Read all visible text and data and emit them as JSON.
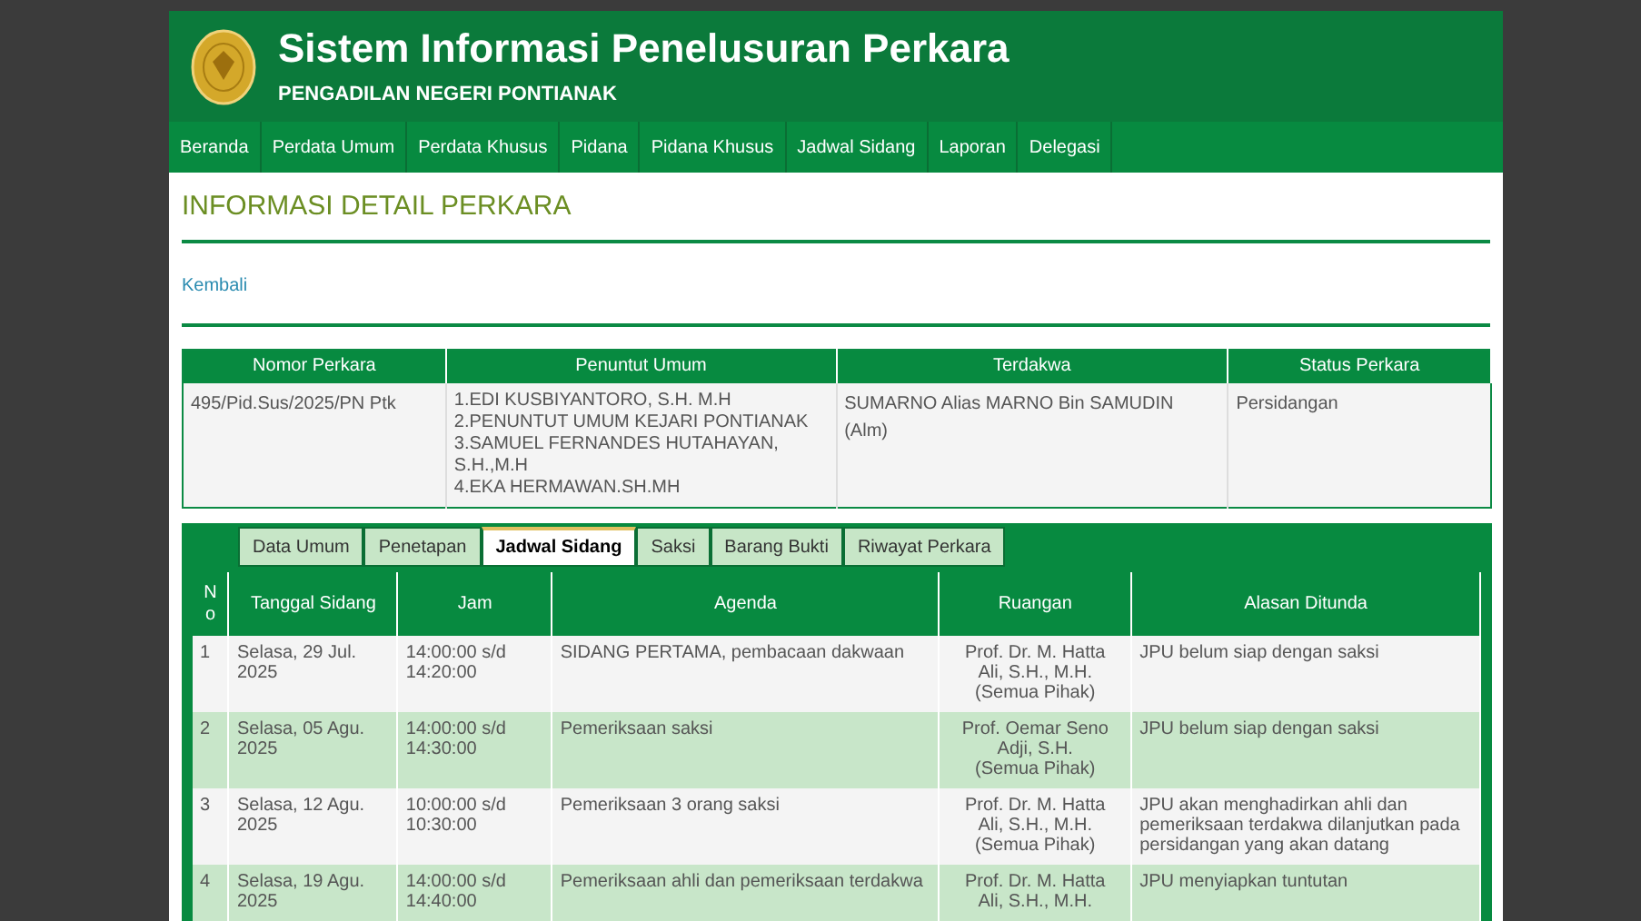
{
  "header": {
    "title": "Sistem Informasi Penelusuran Perkara",
    "subtitle": "PENGADILAN NEGERI PONTIANAK"
  },
  "nav": [
    {
      "label": "Beranda"
    },
    {
      "label": "Perdata Umum"
    },
    {
      "label": "Perdata Khusus"
    },
    {
      "label": "Pidana"
    },
    {
      "label": "Pidana Khusus"
    },
    {
      "label": "Jadwal Sidang"
    },
    {
      "label": "Laporan"
    },
    {
      "label": "Delegasi"
    }
  ],
  "page_title": "INFORMASI DETAIL PERKARA",
  "back_link": "Kembali",
  "case_table": {
    "columns": [
      "Nomor Perkara",
      "Penuntut Umum",
      "Terdakwa",
      "Status Perkara"
    ],
    "row": {
      "nomor": "495/Pid.Sus/2025/PN Ptk",
      "penuntut": [
        "1.EDI KUSBIYANTORO, S.H. M.H",
        "2.PENUNTUT UMUM KEJARI PONTIANAK",
        "3.SAMUEL FERNANDES HUTAHAYAN, S.H.,M.H",
        "4.EKA HERMAWAN.SH.MH"
      ],
      "terdakwa": "SUMARNO Alias MARNO Bin SAMUDIN (Alm)",
      "status": "Persidangan"
    }
  },
  "tabs": [
    {
      "label": "Data Umum",
      "selected": false
    },
    {
      "label": "Penetapan",
      "selected": false
    },
    {
      "label": "Jadwal Sidang",
      "selected": true
    },
    {
      "label": "Saksi",
      "selected": false
    },
    {
      "label": "Barang Bukti",
      "selected": false
    },
    {
      "label": "Riwayat Perkara",
      "selected": false
    }
  ],
  "schedule_table": {
    "columns": [
      "No",
      "Tanggal Sidang",
      "Jam",
      "Agenda",
      "Ruangan",
      "Alasan Ditunda"
    ],
    "rows": [
      {
        "no": "1",
        "tanggal": "Selasa, 29 Jul. 2025",
        "jam": "14:00:00 s/d 14:20:00",
        "agenda": "SIDANG PERTAMA, pembacaan dakwaan",
        "ruangan": [
          "Prof. Dr. M. Hatta",
          "Ali, S.H., M.H.",
          "(Semua Pihak)"
        ],
        "alasan": "JPU belum siap dengan saksi"
      },
      {
        "no": "2",
        "tanggal": "Selasa, 05 Agu. 2025",
        "jam": "14:00:00 s/d 14:30:00",
        "agenda": "Pemeriksaan saksi",
        "ruangan": [
          "Prof. Oemar Seno",
          "Adji, S.H.",
          "(Semua Pihak)"
        ],
        "alasan": "JPU belum siap dengan saksi"
      },
      {
        "no": "3",
        "tanggal": "Selasa, 12 Agu. 2025",
        "jam": "10:00:00 s/d 10:30:00",
        "agenda": "Pemeriksaan 3 orang saksi",
        "ruangan": [
          "Prof. Dr. M. Hatta",
          "Ali, S.H., M.H.",
          "(Semua Pihak)"
        ],
        "alasan": "JPU akan menghadirkan ahli dan pemeriksaan terdakwa dilanjutkan pada persidangan yang akan datang"
      },
      {
        "no": "4",
        "tanggal": "Selasa, 19 Agu. 2025",
        "jam": "14:00:00 s/d 14:40:00",
        "agenda": "Pemeriksaan ahli dan pemeriksaan terdakwa",
        "ruangan": [
          "Prof. Dr. M. Hatta",
          "Ali, S.H., M.H."
        ],
        "alasan": "JPU menyiapkan tuntutan"
      }
    ]
  }
}
